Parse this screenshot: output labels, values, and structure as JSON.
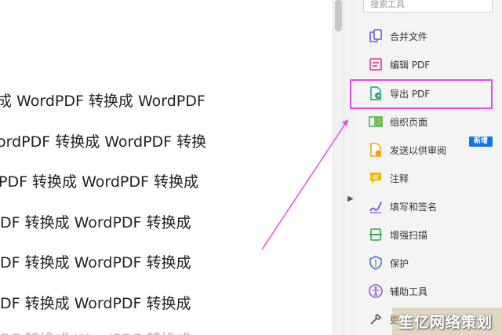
{
  "document": {
    "lines": [
      "成 WordPDF 转换成 WordPDF",
      "ordPDF 转换成 WordPDF 转换",
      "PDF 转换成 WordPDF 转换成",
      "DF 转换成 WordPDF 转换成",
      "DF 转换成 WordPDF 转换成",
      "DF 转换成 WordPDF 转换成"
    ]
  },
  "tools_pane": {
    "search_placeholder": "搜索工具",
    "items": [
      {
        "label": "合并文件",
        "icon": "combine-files-icon"
      },
      {
        "label": "编辑 PDF",
        "icon": "edit-pdf-icon"
      },
      {
        "label": "导出 PDF",
        "icon": "export-pdf-icon"
      },
      {
        "label": "组织页面",
        "icon": "organize-pages-icon"
      },
      {
        "label": "发送以供审阅",
        "icon": "send-for-review-icon"
      },
      {
        "label": "注释",
        "icon": "comment-icon"
      },
      {
        "label": "填写和签名",
        "icon": "fill-sign-icon"
      },
      {
        "label": "增强扫描",
        "icon": "enhance-scan-icon"
      },
      {
        "label": "保护",
        "icon": "protect-icon"
      },
      {
        "label": "辅助工具",
        "icon": "accessibility-icon"
      },
      {
        "label": "更",
        "icon": "more-tools-icon"
      }
    ],
    "new_badge": "新增"
  },
  "colors": {
    "highlight": "#e64be6",
    "badge": "#1473e6"
  },
  "watermark": "笙亿网络策划"
}
